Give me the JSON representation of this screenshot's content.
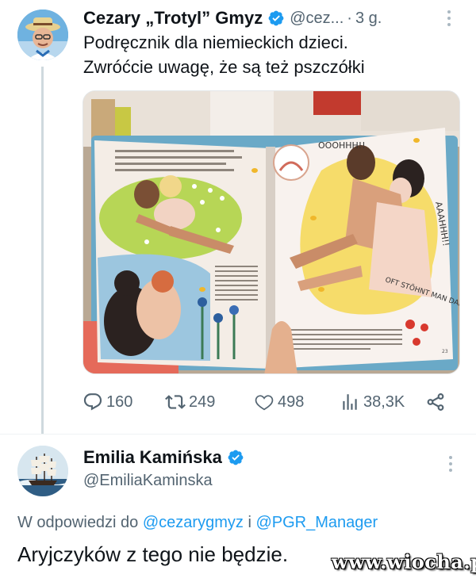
{
  "tweet": {
    "author_name": "Cezary „Trotyl” Gmyz",
    "handle": "@cez...",
    "separator": "·",
    "time": "3 g.",
    "text_line1": "Podręcznik dla niemieckich dzieci.",
    "text_line2": "Zwróćcie uwagę, że są też pszczółki",
    "image_texts": {
      "speech_top": "OOOHHH!!",
      "speech_side": "AAAHHH!!",
      "caption_right": "OFT STÖHNT MAN DABEI!",
      "page_number": "23"
    },
    "actions": {
      "replies": "160",
      "retweets": "249",
      "likes": "498",
      "views": "38,3K"
    }
  },
  "reply": {
    "author_name": "Emilia Kamińska",
    "handle": "@EmiliaKaminska",
    "reply_prefix": "W odpowiedzi do",
    "mention1": "@cezarygmyz",
    "conjunction": "i",
    "mention2": "@PGR_Manager",
    "text": "Aryjczyków z tego nie będzie."
  },
  "watermark": "www.wiocha.pl",
  "colors": {
    "text": "#0f1419",
    "secondary": "#536471",
    "link": "#1d9bf0",
    "verified": "#1d9bf0",
    "divider": "#eff3f4"
  },
  "icons": [
    "verified-badge-icon",
    "more-options-icon",
    "reply-icon",
    "retweet-icon",
    "like-icon",
    "views-icon",
    "share-icon"
  ]
}
